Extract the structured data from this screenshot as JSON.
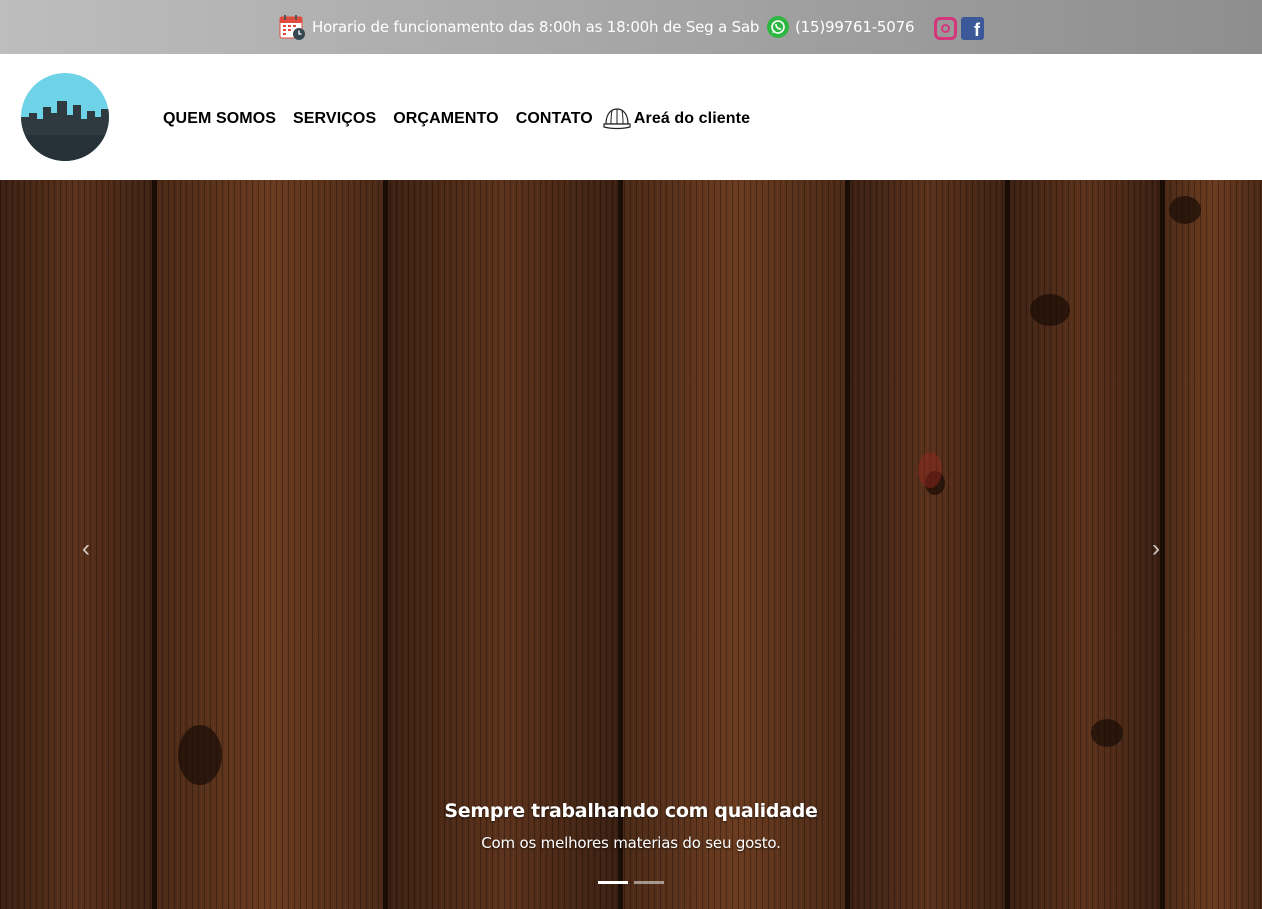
{
  "topbar": {
    "hours_text": "Horario de funcionamento das 8:00h as 18:00h de Seg a Sab",
    "phone_text": "(15)99761-5076",
    "icons": [
      "calendar-icon",
      "whatsapp-icon",
      "instagram-icon",
      "facebook-icon"
    ],
    "colors": {
      "background_start": "#bdbdbd",
      "background_end": "#8e8e8e",
      "whatsapp": "#2fb640",
      "instagram": "#d4367b",
      "facebook": "#3b5998"
    }
  },
  "header": {
    "nav": [
      {
        "label": "QUEM SOMOS"
      },
      {
        "label": "SERVIÇOS"
      },
      {
        "label": "ORÇAMENTO"
      },
      {
        "label": "CONTATO"
      }
    ],
    "client_area_label": "Areá do cliente",
    "logo_colors": {
      "sky": "#6fd3e8",
      "city": "#2f3a40"
    }
  },
  "carousel": {
    "caption_title": "Sempre trabalhando com qualidade",
    "caption_text": "Com os melhores materias do seu gosto.",
    "slides": 2,
    "active_slide": 1,
    "prev_glyph": "‹",
    "next_glyph": "›"
  }
}
